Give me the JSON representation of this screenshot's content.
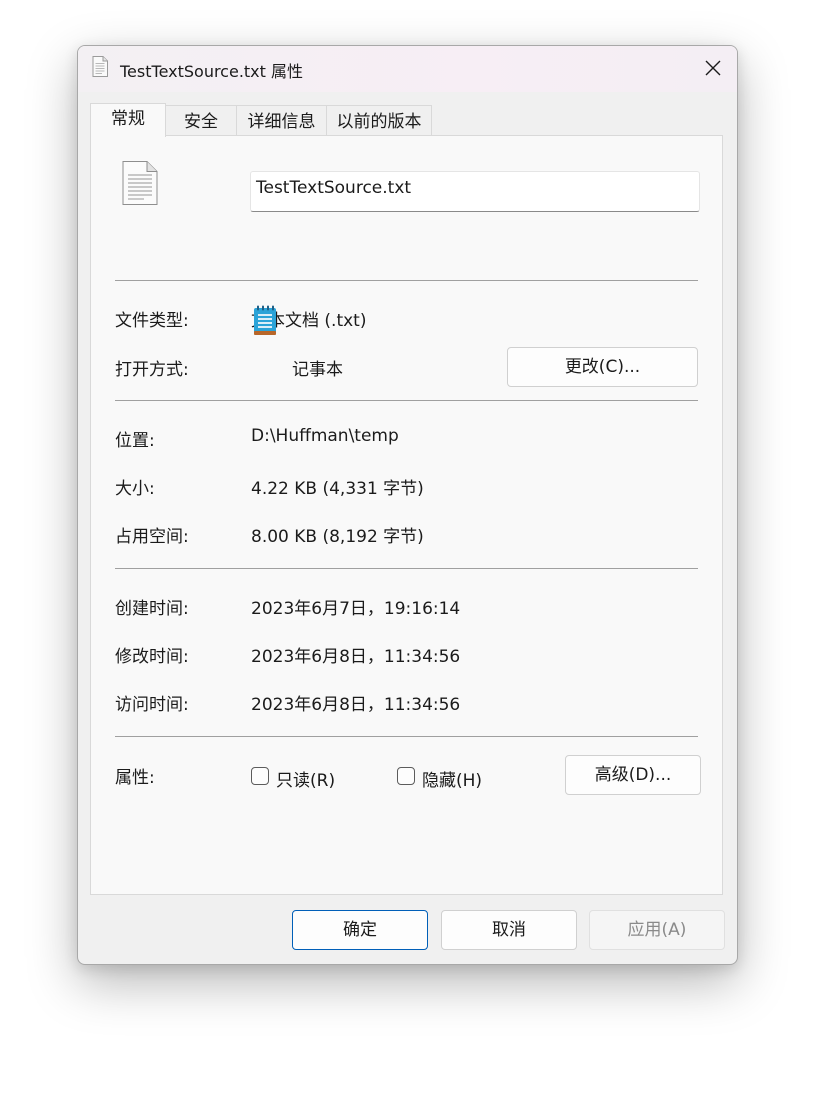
{
  "window": {
    "title": "TestTextSource.txt 属性",
    "close_icon": "close-icon"
  },
  "tabs": [
    {
      "label": "常规",
      "active": true
    },
    {
      "label": "安全",
      "active": false
    },
    {
      "label": "详细信息",
      "active": false
    },
    {
      "label": "以前的版本",
      "active": false
    }
  ],
  "general": {
    "file_name": "TestTextSource.txt",
    "type_label": "文件类型:",
    "type_value": "文本文档 (.txt)",
    "opens_with_label": "打开方式:",
    "opens_with_value": "记事本",
    "change_button": "更改(C)...",
    "location_label": "位置:",
    "location_value": "D:\\Huffman\\temp",
    "size_label": "大小:",
    "size_value": "4.22 KB (4,331 字节)",
    "size_on_disk_label": "占用空间:",
    "size_on_disk_value": "8.00 KB (8,192 字节)",
    "created_label": "创建时间:",
    "created_value": "2023年6月7日，19:16:14",
    "modified_label": "修改时间:",
    "modified_value": "2023年6月8日，11:34:56",
    "accessed_label": "访问时间:",
    "accessed_value": "2023年6月8日，11:34:56",
    "attributes_label": "属性:",
    "readonly_label": "只读(R)",
    "readonly_checked": false,
    "hidden_label": "隐藏(H)",
    "hidden_checked": false,
    "advanced_button": "高级(D)..."
  },
  "footer": {
    "ok": "确定",
    "cancel": "取消",
    "apply": "应用(A)"
  },
  "colors": {
    "accent": "#005fb8",
    "disabled_text": "#8a8a8a"
  }
}
